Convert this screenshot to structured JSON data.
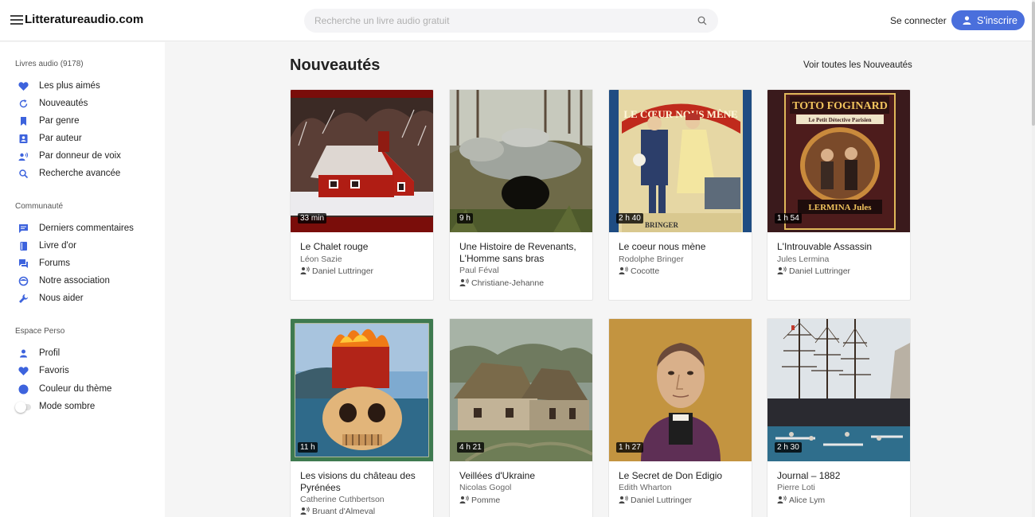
{
  "header": {
    "logo": "Litteratureaudio.com",
    "search_placeholder": "Recherche un livre audio gratuit",
    "login_label": "Se connecter",
    "signup_label": "S'inscrire"
  },
  "colors": {
    "accent": "#4a6fdc",
    "icon_blue": "#3d63dd"
  },
  "sidebar": {
    "library": {
      "title": "Livres audio (9178)",
      "items": [
        {
          "label": "Les plus aimés",
          "icon": "heart-icon"
        },
        {
          "label": "Nouveautés",
          "icon": "refresh-icon"
        },
        {
          "label": "Par genre",
          "icon": "bookmark-icon"
        },
        {
          "label": "Par auteur",
          "icon": "contact-icon"
        },
        {
          "label": "Par donneur de voix",
          "icon": "voice-icon"
        },
        {
          "label": "Recherche avancée",
          "icon": "search-icon"
        }
      ]
    },
    "community": {
      "title": "Communauté",
      "items": [
        {
          "label": "Derniers commentaires",
          "icon": "comment-icon"
        },
        {
          "label": "Livre d'or",
          "icon": "book-icon"
        },
        {
          "label": "Forums",
          "icon": "forum-icon"
        },
        {
          "label": "Notre association",
          "icon": "association-icon"
        },
        {
          "label": "Nous aider",
          "icon": "wrench-icon"
        }
      ]
    },
    "personal": {
      "title": "Espace Perso",
      "items": [
        {
          "label": "Profil",
          "icon": "user-icon"
        },
        {
          "label": "Favoris",
          "icon": "heart-icon"
        },
        {
          "label": "Couleur du thème",
          "icon": "color-dot-icon"
        },
        {
          "label": "Mode sombre",
          "icon": "toggle-switch"
        }
      ]
    }
  },
  "main": {
    "title": "Nouveautés",
    "see_all": "Voir toutes les Nouveautés",
    "books": [
      {
        "title": "Le Chalet rouge",
        "author": "Léon Sazie",
        "reader": "Daniel Luttringer",
        "duration": "33 min"
      },
      {
        "title": "Une Histoire de Revenants, L'Homme sans bras",
        "author": "Paul Féval",
        "reader": "Christiane-Jehanne",
        "duration": "9 h"
      },
      {
        "title": "Le coeur nous mène",
        "author": "Rodolphe Bringer",
        "reader": "Cocotte",
        "duration": "2 h 40",
        "cover_text": [
          "LE CŒUR NOUS MÈNE",
          "BRINGER"
        ]
      },
      {
        "title": "L'Introuvable Assassin",
        "author": "Jules Lermina",
        "reader": "Daniel Luttringer",
        "duration": "1 h 54",
        "cover_text": [
          "TOTO FOGINARD",
          "Le Petit Détective Parisien",
          "LERMINA Jules"
        ]
      },
      {
        "title": "Les visions du château des Pyrénées",
        "author": "Catherine Cuthbertson",
        "reader": "Bruant d'Almeval",
        "duration": "11 h"
      },
      {
        "title": "Veillées d'Ukraine",
        "author": "Nicolas Gogol",
        "reader": "Pomme",
        "duration": "4 h 21"
      },
      {
        "title": "Le Secret de Don Edigio",
        "author": "Edith Wharton",
        "reader": "Daniel Luttringer",
        "duration": "1 h 27"
      },
      {
        "title": "Journal – 1882",
        "author": "Pierre Loti",
        "reader": "Alice Lym",
        "duration": "2 h 30"
      }
    ]
  }
}
